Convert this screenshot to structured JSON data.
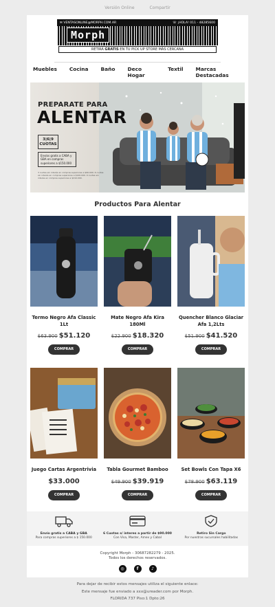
{
  "top_links": {
    "web": "Versión Online",
    "share": "Compartir"
  },
  "header": {
    "email": "VENTASONLINE@MORPH.COM.AR",
    "phone": "¡HOLA! 011 - 48285600",
    "logo": "Morph",
    "bar_pre": "RETIRÁ ",
    "bar_bold": "GRATIS",
    "bar_post": " EN TU PICK UP STORE MÁS CERCANA"
  },
  "nav": [
    "Muebles",
    "Cocina",
    "Baño",
    "Deco Hogar",
    "Textil",
    "Marcas Destacadas"
  ],
  "hero": {
    "line1": "PREPARATE PARA",
    "line2": "ALENTAR",
    "cuotas": "3|6|9 CUOTAS",
    "envio": "Envíos gratis a CABA y GBA en compras superiores a $150.000",
    "legal": "3 cuotas sin interés en compras superiores a $90.000. 6 cuotas sin interés en compras superiores a $120.000. 9 cuotas sin interés en compras superiores a $210.000."
  },
  "section_title": "Productos Para Alentar",
  "products": [
    {
      "name": "Termo Negro Afa Classic 1Lt",
      "old": "$63.900",
      "price": "$51.120",
      "button": "COMPRAR"
    },
    {
      "name": "Mate Negro Afa Kira 180Ml",
      "old": "$22.900",
      "price": "$18.320",
      "button": "COMPRAR"
    },
    {
      "name": "Quencher Blanco Glaciar Afa 1,2Lts",
      "old": "$51.900",
      "price": "$41.520",
      "button": "COMPRAR"
    },
    {
      "name": "Juego Cartas Argentrivia",
      "old": "",
      "price": "$33.000",
      "button": "COMPRAR"
    },
    {
      "name": "Tabla Gourmet Bamboo",
      "old": "$49.900",
      "price": "$39.919",
      "button": "COMPRAR"
    },
    {
      "name": "Set Bowls Con Tapa X6",
      "old": "$78.900",
      "price": "$63.119",
      "button": "COMPRAR"
    }
  ],
  "features": [
    {
      "icon": "truck-icon",
      "title": "Envío gratis a CABA y GBA",
      "sub": "Para compras superiores a $ 150.000"
    },
    {
      "icon": "card-icon",
      "title": "6 Cuotas s/ interes a partir de $90.000",
      "sub": "Con Visa, Master, Amex y Cabal"
    },
    {
      "icon": "shield-check-icon",
      "title": "Retiro Sin Cargo",
      "sub": "Por nuestras sucursales habilitadas"
    }
  ],
  "footer": {
    "copyright": "Copyright Morph - 30687282279 - 2025.",
    "rights": "Todos los derechos reservados."
  },
  "unsubscribe": {
    "line1": "Para dejar de recibir estos mensajes utiliza el siguiente enlace:",
    "line2": "Este mensaje fue enviado a xxx@ureader.com por Morph.",
    "line3": "FLORIDA 737 Piso:1 Dpto:26"
  },
  "colors": {
    "dark": "#111111",
    "button": "#333333",
    "background": "#ececec",
    "sky": "#7fb7e0"
  }
}
